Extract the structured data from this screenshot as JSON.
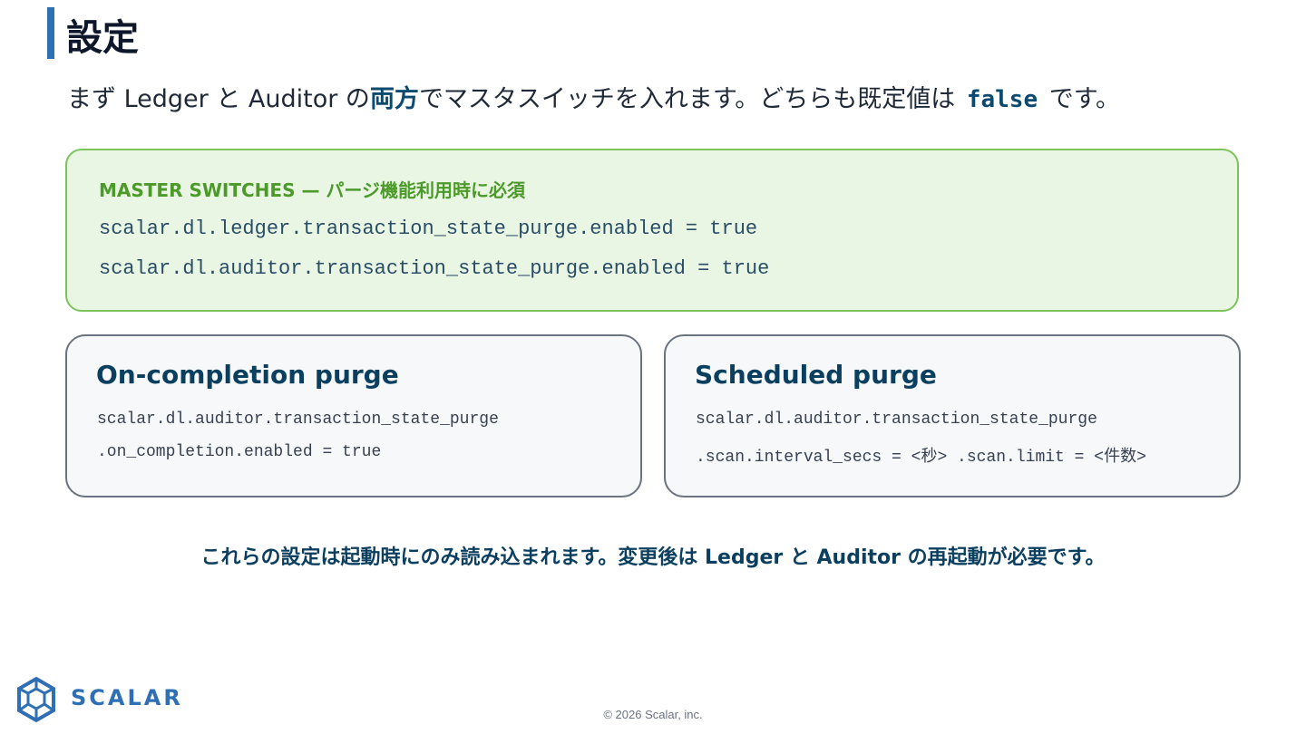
{
  "page": {
    "title": "設定",
    "lead_before": "まず Ledger と Auditor の",
    "lead_emphasis": "両方",
    "lead_middle": "でマスタスイッチを入れます。どちらも既定値は ",
    "lead_code": "false",
    "lead_after": " です。"
  },
  "master_switches": {
    "label": "MASTER SWITCHES — パージ機能利用時に必須",
    "lines": [
      "scalar.dl.ledger.transaction_state_purge.enabled = true",
      "scalar.dl.auditor.transaction_state_purge.enabled = true"
    ]
  },
  "cards": [
    {
      "title": "On-completion purge",
      "lines": [
        "scalar.dl.auditor.transaction_state_purge",
        ".on_completion.enabled = true"
      ]
    },
    {
      "title": "Scheduled purge",
      "lines": [
        "scalar.dl.auditor.transaction_state_purge",
        ".scan.interval_secs = <秒> .scan.limit = <件数>"
      ]
    }
  ],
  "notice": "これらの設定は起動時にのみ読み込まれます。変更後は Ledger と Auditor の再起動が必要です。",
  "footer": {
    "logo_text": "SCALAR",
    "logo_icon": "scalar-logo-icon",
    "copyright": "© 2026 Scalar, inc."
  },
  "colors": {
    "accent": "#2f6fb5",
    "heading_blue": "#0b3f5f",
    "master_green_border": "#7cc35c",
    "master_green_text": "#4c9a2a",
    "master_bg": "#e9f6e3",
    "card_border": "#6b7280",
    "card_bg": "#f6f8fa"
  }
}
